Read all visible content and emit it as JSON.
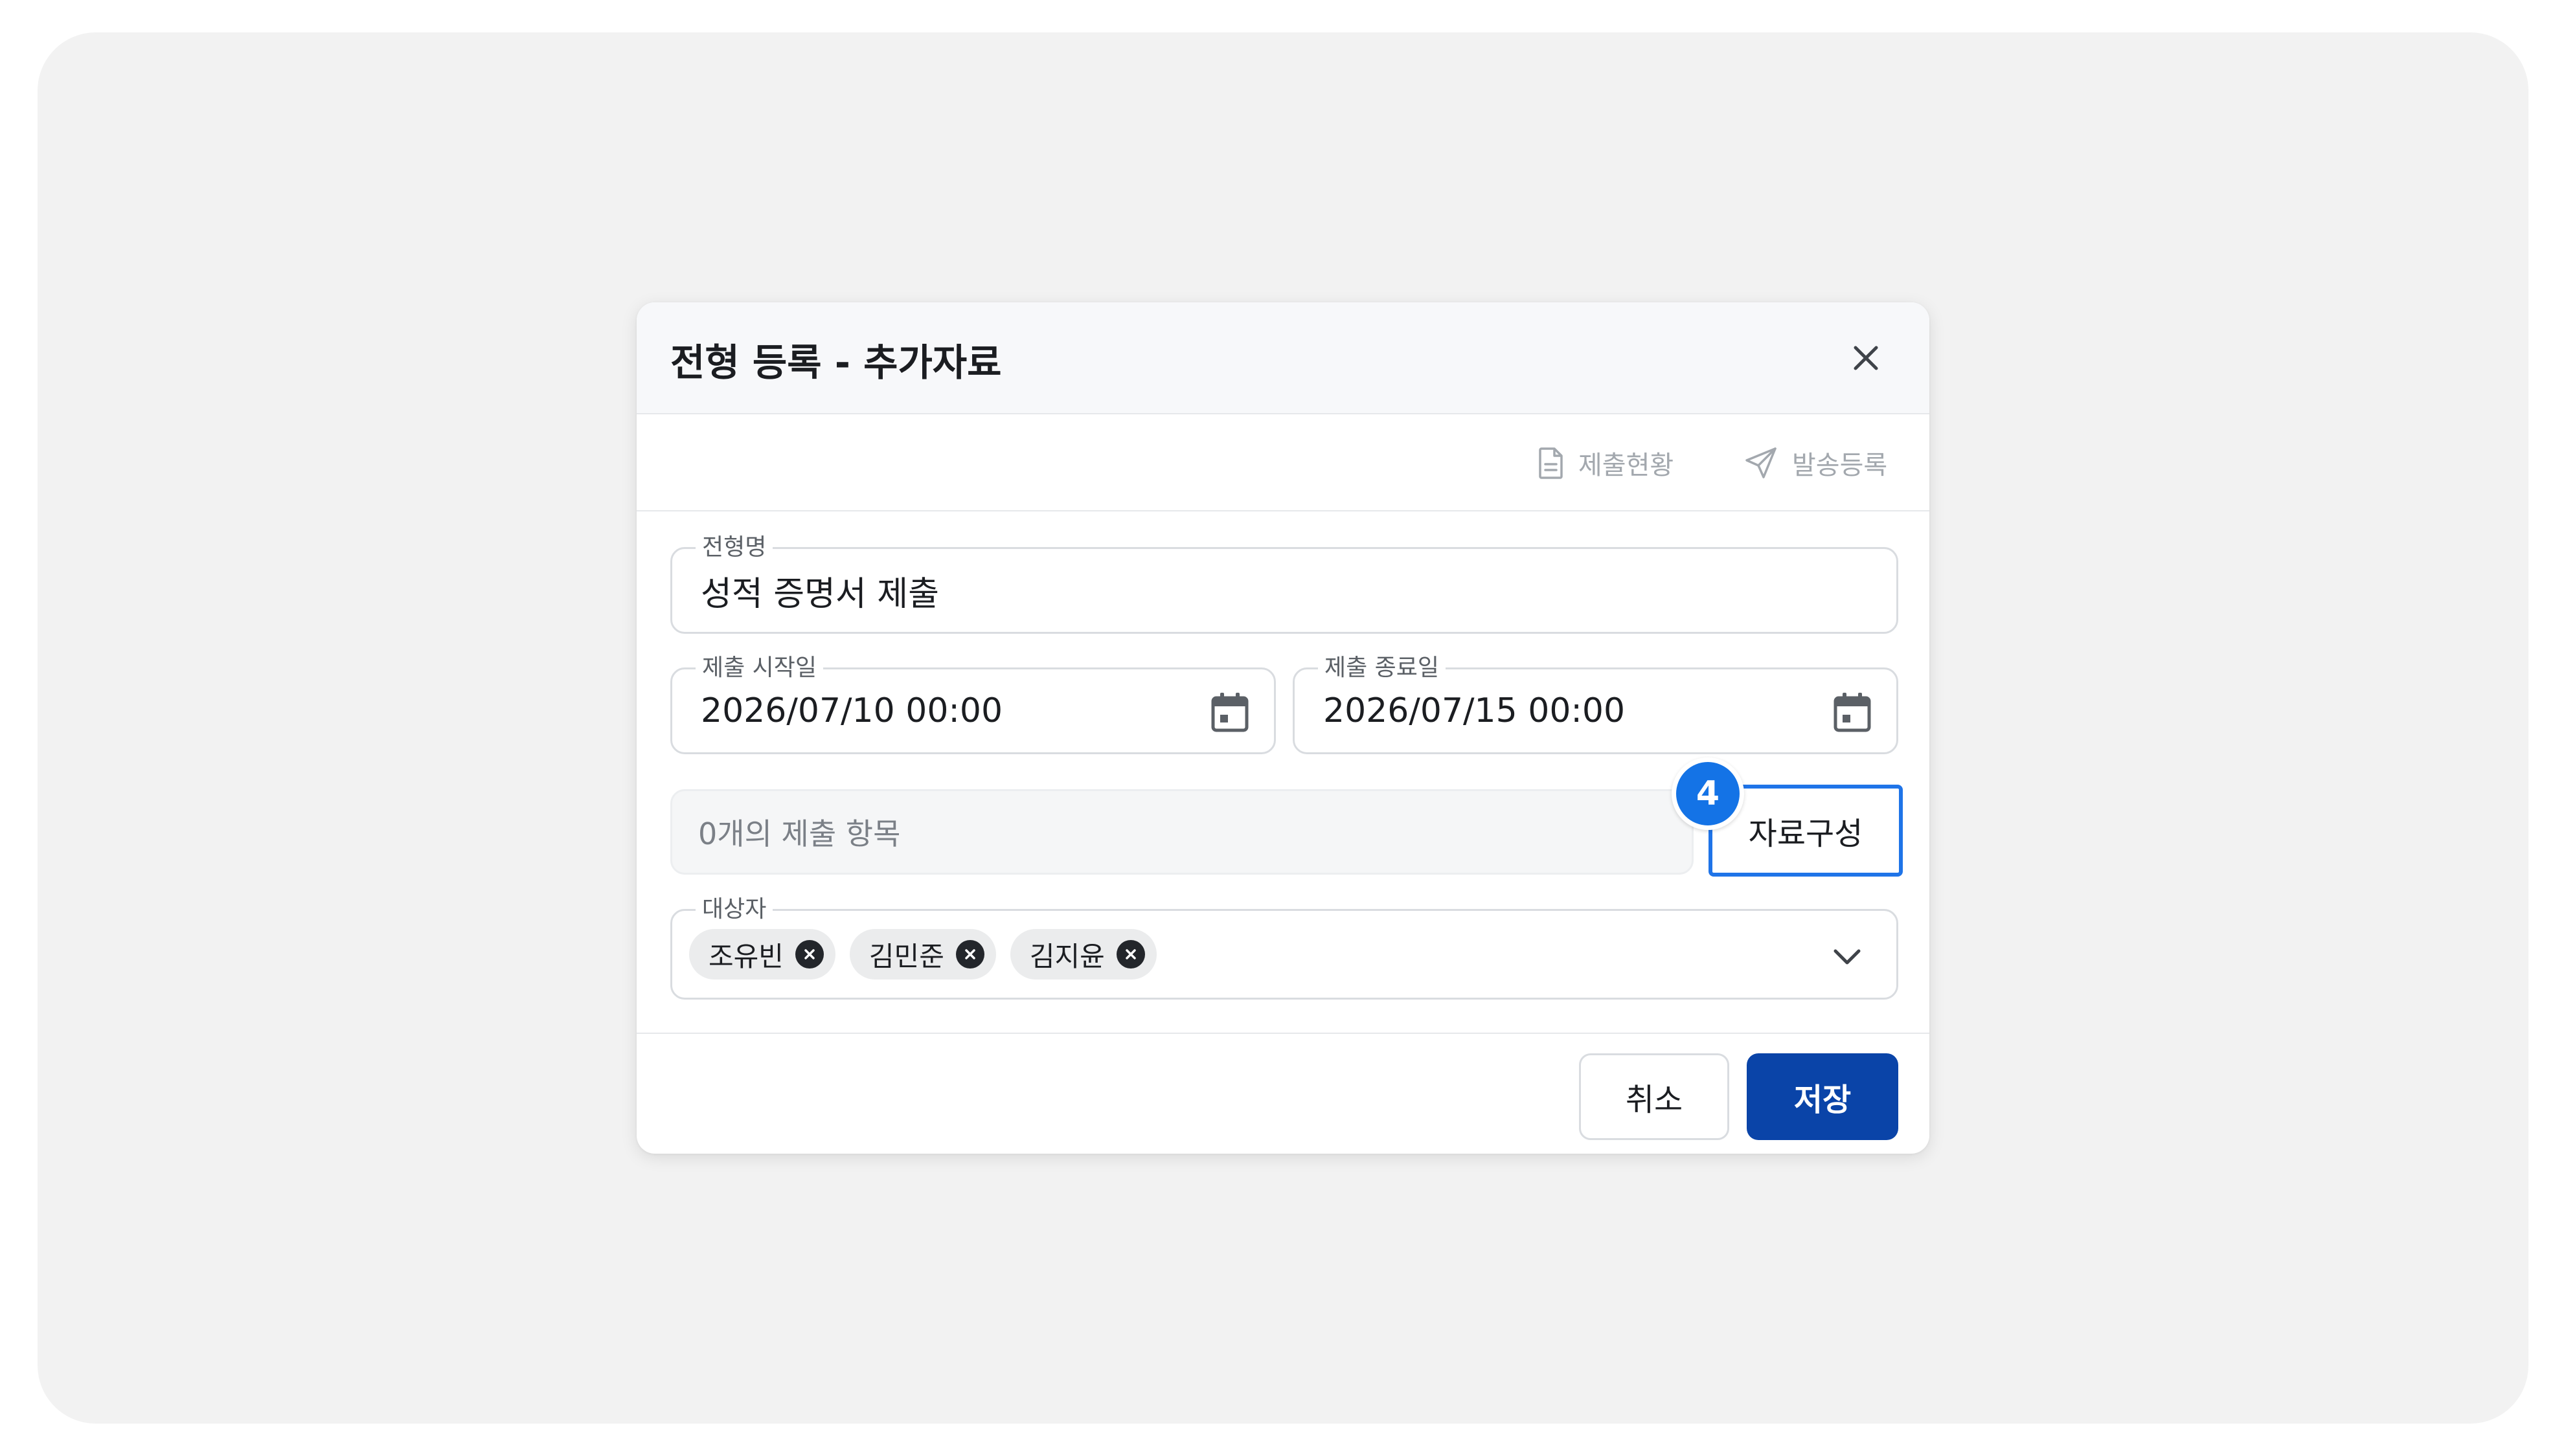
{
  "dialog": {
    "title": "전형 등록 - 추가자료"
  },
  "toolbar": {
    "status_label": "제출현황",
    "send_label": "발송등록"
  },
  "form": {
    "name": {
      "label": "전형명",
      "value": "성적 증명서 제출"
    },
    "start_date": {
      "label": "제출 시작일",
      "value": "2026/07/10 00:00"
    },
    "end_date": {
      "label": "제출 종료일",
      "value": "2026/07/15 00:00"
    },
    "items": {
      "summary": "0개의 제출 항목",
      "compose_label": "자료구성",
      "step_badge": "4"
    },
    "targets": {
      "label": "대상자",
      "chips": [
        "조유빈",
        "김민준",
        "김지윤"
      ]
    }
  },
  "footer": {
    "cancel_label": "취소",
    "save_label": "저장"
  },
  "colors": {
    "primary": "#0a44a8",
    "highlight": "#1f74e8",
    "badge": "#1473e6"
  }
}
